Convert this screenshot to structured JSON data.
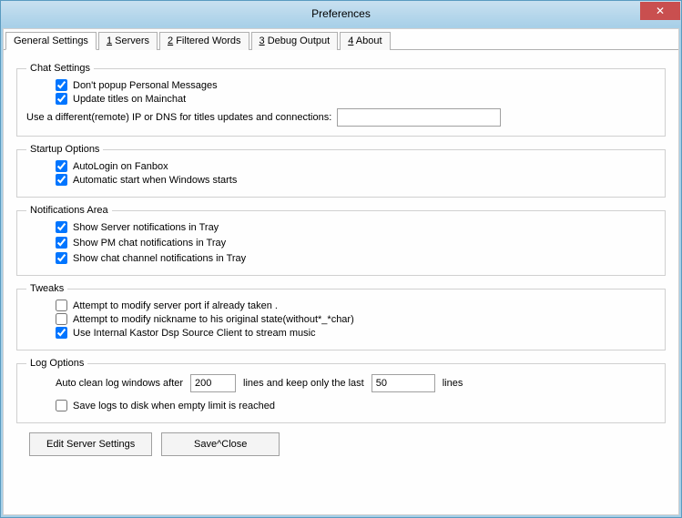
{
  "window": {
    "title": "Preferences",
    "close_glyph": "✕"
  },
  "tabs": {
    "t0": "General Settings",
    "t1_prefix": "1",
    "t1_rest": " Servers",
    "t2_prefix": "2",
    "t2_rest": " Filtered Words",
    "t3_prefix": "3",
    "t3_rest": " Debug Output",
    "t4_prefix": "4",
    "t4_rest": " About"
  },
  "chat": {
    "legend": "Chat Settings",
    "no_popup": "Don't popup Personal Messages",
    "update_titles": "Update titles on Mainchat",
    "ip_label": "Use a different(remote) IP or DNS  for titles updates and connections:",
    "ip_value": ""
  },
  "startup": {
    "legend": "Startup Options",
    "autologin": "AutoLogin on Fanbox",
    "autostart": "Automatic start when Windows starts"
  },
  "notify": {
    "legend": "Notifications Area",
    "server": "Show Server notifications in Tray",
    "pm": "Show PM chat notifications in Tray",
    "channel": "Show chat channel notifications in Tray"
  },
  "tweaks": {
    "legend": "Tweaks",
    "port": "Attempt to modify server  port if already taken .",
    "nick": "Attempt to modify nickname to his original  state(without*_*char)",
    "kastor": "Use Internal Kastor Dsp Source Client to stream music"
  },
  "log": {
    "legend": "Log Options",
    "autoclean_prefix": "Auto clean log windows after",
    "lines_mid": "lines  and keep only the last",
    "lines_suffix": "lines",
    "val1": "200",
    "val2": "50",
    "save_disk": "Save logs to disk when empty limit is reached"
  },
  "buttons": {
    "edit_server": "Edit Server Settings",
    "save_close": "Save^Close"
  }
}
